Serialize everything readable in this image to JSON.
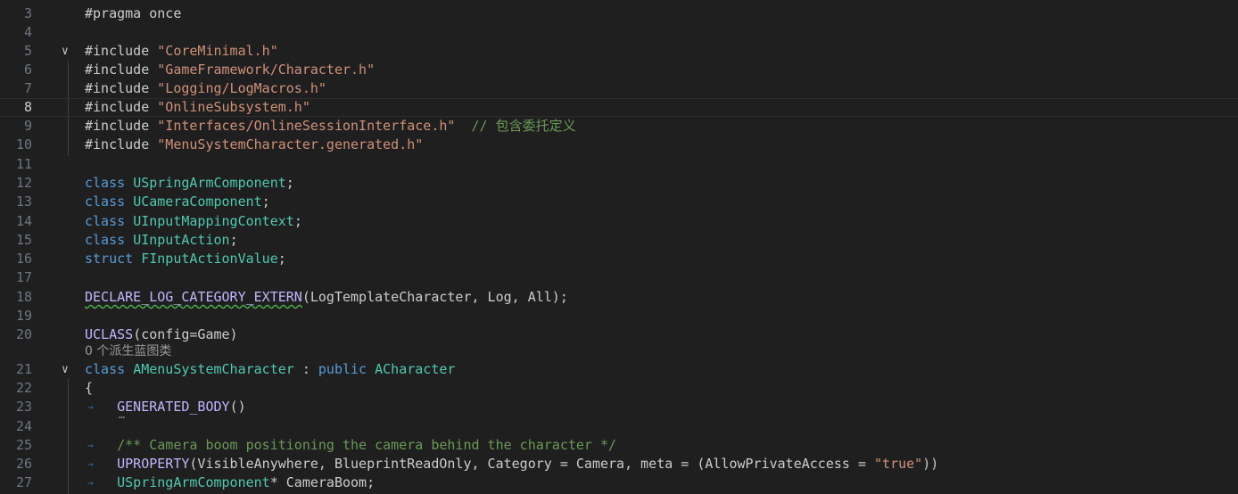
{
  "active_line": 8,
  "colors": {
    "background": "#1f1f1f",
    "line_number": "#6e7681",
    "directive": "#c586c0",
    "include_keyword": "#c586c0",
    "string": "#ce9178",
    "keyword": "#569cd6",
    "type": "#4ec9b0",
    "macro": "#beb7ff",
    "comment": "#6a9955",
    "default": "#cccccc"
  },
  "codelens": {
    "text": "0 个派生蓝图类"
  },
  "lines": [
    {
      "n": "3",
      "tokens": [
        {
          "t": "#pragma",
          "c": "default"
        },
        {
          "t": " ",
          "c": "default"
        },
        {
          "t": "once",
          "c": "default"
        }
      ]
    },
    {
      "n": "4",
      "tokens": []
    },
    {
      "n": "5",
      "tokens": [
        {
          "t": "#include",
          "c": "default"
        },
        {
          "t": " ",
          "c": "default"
        },
        {
          "t": "\"CoreMinimal.h\"",
          "c": "string"
        }
      ]
    },
    {
      "n": "6",
      "tokens": [
        {
          "t": "#include",
          "c": "default"
        },
        {
          "t": " ",
          "c": "default"
        },
        {
          "t": "\"GameFramework/Character.h\"",
          "c": "string"
        }
      ]
    },
    {
      "n": "7",
      "tokens": [
        {
          "t": "#include",
          "c": "default"
        },
        {
          "t": " ",
          "c": "default"
        },
        {
          "t": "\"Logging/LogMacros.h\"",
          "c": "string"
        }
      ]
    },
    {
      "n": "8",
      "tokens": [
        {
          "t": "#include",
          "c": "default"
        },
        {
          "t": " ",
          "c": "default"
        },
        {
          "t": "\"OnlineSubsystem.h\"",
          "c": "string"
        }
      ]
    },
    {
      "n": "9",
      "tokens": [
        {
          "t": "#include",
          "c": "default"
        },
        {
          "t": " ",
          "c": "default"
        },
        {
          "t": "\"Interfaces/OnlineSessionInterface.h\"",
          "c": "string"
        },
        {
          "t": "  ",
          "c": "default"
        },
        {
          "t": "// 包含委托定义",
          "c": "comment"
        }
      ]
    },
    {
      "n": "10",
      "tokens": [
        {
          "t": "#include",
          "c": "default"
        },
        {
          "t": " ",
          "c": "default"
        },
        {
          "t": "\"MenuSystemCharacter.generated.h\"",
          "c": "string"
        }
      ]
    },
    {
      "n": "11",
      "tokens": []
    },
    {
      "n": "12",
      "tokens": [
        {
          "t": "class",
          "c": "keyword"
        },
        {
          "t": " ",
          "c": "default"
        },
        {
          "t": "USpringArmComponent",
          "c": "type"
        },
        {
          "t": ";",
          "c": "default"
        }
      ]
    },
    {
      "n": "13",
      "tokens": [
        {
          "t": "class",
          "c": "keyword"
        },
        {
          "t": " ",
          "c": "default"
        },
        {
          "t": "UCameraComponent",
          "c": "type"
        },
        {
          "t": ";",
          "c": "default"
        }
      ]
    },
    {
      "n": "14",
      "tokens": [
        {
          "t": "class",
          "c": "keyword"
        },
        {
          "t": " ",
          "c": "default"
        },
        {
          "t": "UInputMappingContext",
          "c": "type"
        },
        {
          "t": ";",
          "c": "default"
        }
      ]
    },
    {
      "n": "15",
      "tokens": [
        {
          "t": "class",
          "c": "keyword"
        },
        {
          "t": " ",
          "c": "default"
        },
        {
          "t": "UInputAction",
          "c": "type"
        },
        {
          "t": ";",
          "c": "default"
        }
      ]
    },
    {
      "n": "16",
      "tokens": [
        {
          "t": "struct",
          "c": "keyword"
        },
        {
          "t": " ",
          "c": "default"
        },
        {
          "t": "FInputActionValue",
          "c": "type"
        },
        {
          "t": ";",
          "c": "default"
        }
      ]
    },
    {
      "n": "17",
      "tokens": []
    },
    {
      "n": "18",
      "tokens": [
        {
          "t": "DECLARE_LOG_CATEGORY_EXTERN",
          "c": "macro",
          "squiggle": true
        },
        {
          "t": "(LogTemplateCharacter, Log, All);",
          "c": "default"
        }
      ]
    },
    {
      "n": "19",
      "tokens": []
    },
    {
      "n": "20",
      "tokens": [
        {
          "t": "UCLASS",
          "c": "macro"
        },
        {
          "t": "(config=Game)",
          "c": "default"
        }
      ]
    },
    {
      "n": "21",
      "tokens": [
        {
          "t": "class",
          "c": "keyword"
        },
        {
          "t": " ",
          "c": "default"
        },
        {
          "t": "AMenuSystemCharacter",
          "c": "type"
        },
        {
          "t": " : ",
          "c": "default"
        },
        {
          "t": "public",
          "c": "keyword"
        },
        {
          "t": " ",
          "c": "default"
        },
        {
          "t": "ACharacter",
          "c": "type"
        }
      ]
    },
    {
      "n": "22",
      "tokens": [
        {
          "t": "{",
          "c": "default"
        }
      ]
    },
    {
      "n": "23",
      "tokens": [
        {
          "t": "    ",
          "c": "default"
        },
        {
          "t": "GENERATED_BODY",
          "c": "macro"
        },
        {
          "t": "()",
          "c": "default"
        }
      ]
    },
    {
      "n": "24",
      "tokens": []
    },
    {
      "n": "25",
      "tokens": [
        {
          "t": "    ",
          "c": "default"
        },
        {
          "t": "/** Camera boom positioning the camera behind the character */",
          "c": "comment"
        }
      ]
    },
    {
      "n": "26",
      "tokens": [
        {
          "t": "    ",
          "c": "default"
        },
        {
          "t": "UPROPERTY",
          "c": "macro"
        },
        {
          "t": "(VisibleAnywhere, BlueprintReadOnly, Category = Camera, meta = (AllowPrivateAccess = ",
          "c": "default"
        },
        {
          "t": "\"true\"",
          "c": "string"
        },
        {
          "t": "))",
          "c": "default"
        }
      ]
    },
    {
      "n": "27",
      "tokens": [
        {
          "t": "    ",
          "c": "default"
        },
        {
          "t": "USpringArmComponent",
          "c": "type"
        },
        {
          "t": "* CameraBoom;",
          "c": "default"
        }
      ]
    }
  ]
}
